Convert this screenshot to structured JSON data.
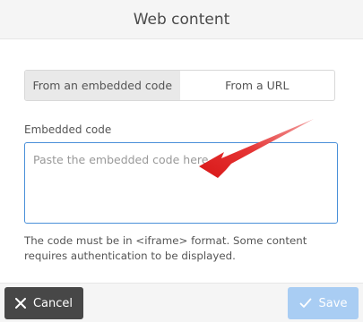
{
  "dialog": {
    "title": "Web content",
    "tabs": [
      {
        "label": "From an embedded code",
        "active": true
      },
      {
        "label": "From a URL",
        "active": false
      }
    ],
    "embedded_code_label": "Embedded code",
    "embedded_code_value": "",
    "embedded_code_placeholder": "Paste the embedded code here",
    "hint": "The code must be in <iframe> format. Some content requires authentication to be displayed.",
    "cancel_label": "Cancel",
    "save_label": "Save"
  },
  "icons": {
    "cancel": "close-icon",
    "save": "check-icon"
  },
  "colors": {
    "accent": "#4a90d9",
    "cancel_bg": "#474747",
    "save_bg_disabled": "#a9cdf3",
    "arrow": "#e02020"
  }
}
